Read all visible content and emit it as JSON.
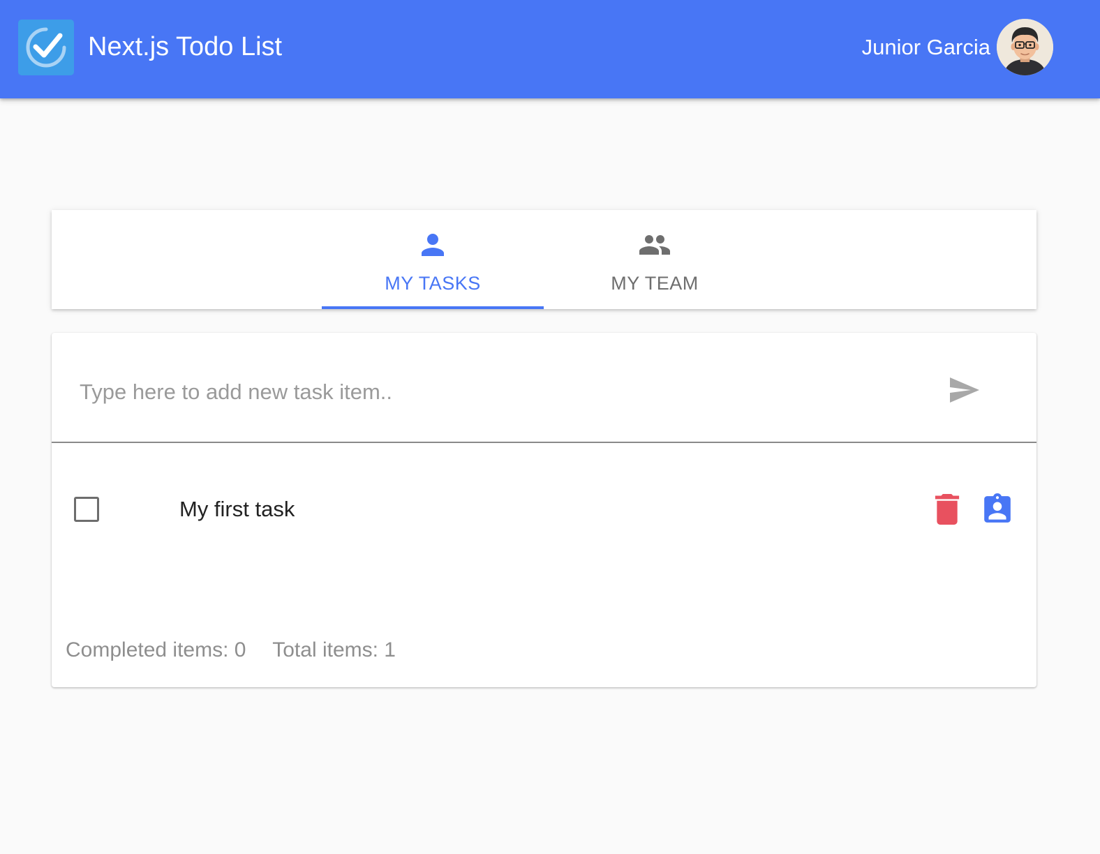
{
  "header": {
    "app_title": "Next.js Todo List",
    "user_name": "Junior Garcia",
    "logo_icon": "check-circle-icon",
    "avatar_icon": "user-avatar",
    "bar_color": "#4876f5"
  },
  "tabs": [
    {
      "label": "MY TASKS",
      "icon": "person-icon",
      "active": true
    },
    {
      "label": "MY TEAM",
      "icon": "people-icon",
      "active": false
    }
  ],
  "new_task": {
    "placeholder": "Type here to add new task item..",
    "value": "",
    "submit_icon": "send-icon"
  },
  "tasks": [
    {
      "text": "My first task",
      "completed": false,
      "actions": [
        "delete-icon",
        "assignment-ind-icon"
      ]
    }
  ],
  "stats": {
    "completed_label": "Completed items: 0",
    "total_label": "Total items: 1"
  },
  "colors": {
    "primary": "#4876f5",
    "delete": "#e8515f",
    "muted_text": "#8e8e8e",
    "logo_bg": "#3d9de8"
  }
}
